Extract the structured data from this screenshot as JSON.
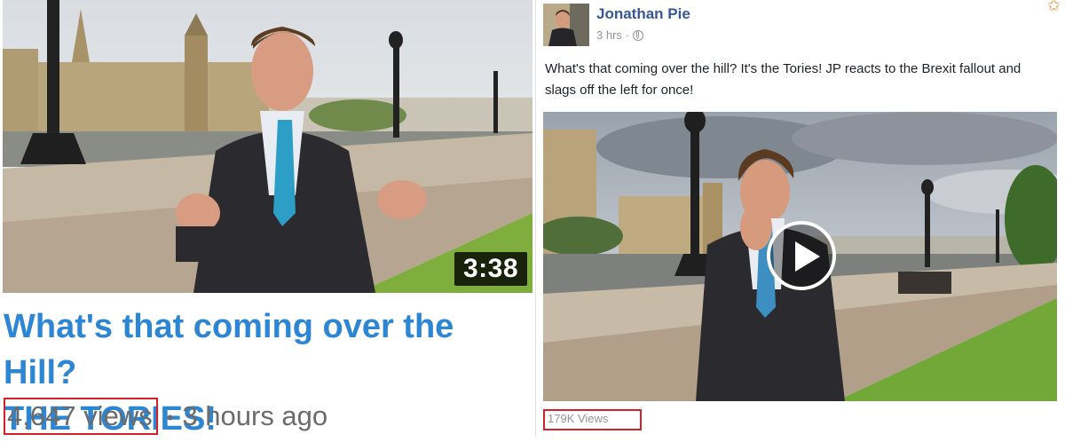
{
  "youtube": {
    "duration": "3:38",
    "title_line1": "What's that coming over the Hill?",
    "title_line2": "THE TORIES!",
    "views": "4,647 views",
    "separator": "•",
    "age": "3 hours ago",
    "title_color": "#2d86d4",
    "highlight_color": "#d4202b"
  },
  "facebook": {
    "page_name": "Jonathan Pie",
    "time": "3 hrs",
    "time_separator": "·",
    "privacy_icon": "globe-icon",
    "post_text": "What's that coming over the hill? It's the Tories! JP reacts to the Brexit fallout and slags off the left for once!",
    "views": "179K Views",
    "link_color": "#365899"
  }
}
